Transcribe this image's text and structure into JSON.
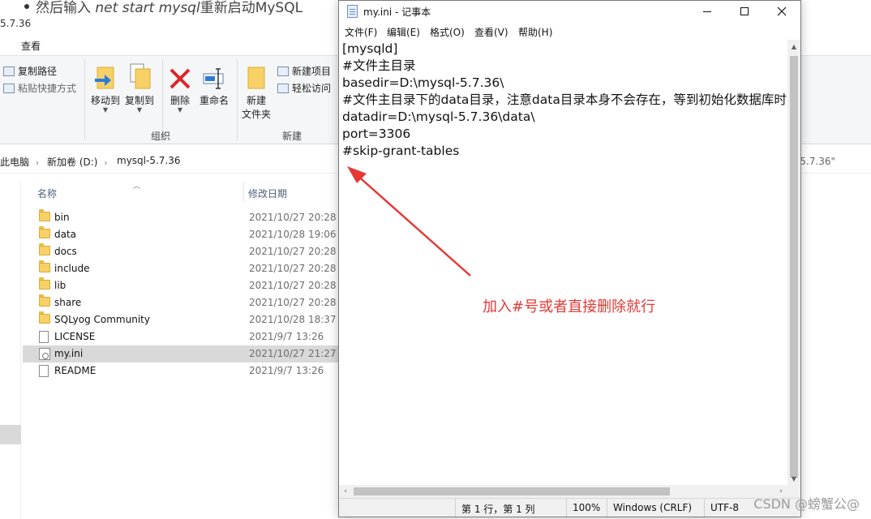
{
  "blog": {
    "line_start": "然后输入 ",
    "line_cmd": "net start mysql",
    "line_end": "重新启动MySQL"
  },
  "explorer": {
    "title_fragment": "5.7.36",
    "tab_view": "查看",
    "ribbon": {
      "copy_path": "复制路径",
      "paste_shortcut": "粘贴快捷方式",
      "move_to": "移动到",
      "copy_to": "复制到",
      "delete": "删除",
      "rename": "重命名",
      "new_folder_line1": "新建",
      "new_folder_line2": "文件夹",
      "new_item": "新建项目",
      "easy_access": "轻松访问",
      "group_organize": "组织",
      "group_new": "新建"
    },
    "breadcrumb": [
      "此电脑",
      "新加卷 (D:)",
      "mysql-5.7.36"
    ],
    "search_fragment": "-5.7.36\"",
    "columns": {
      "name": "名称",
      "date": "修改日期"
    },
    "files": [
      {
        "name": "bin",
        "date": "2021/10/27 20:28",
        "type": "folder"
      },
      {
        "name": "data",
        "date": "2021/10/28 19:06",
        "type": "folder"
      },
      {
        "name": "docs",
        "date": "2021/10/27 20:28",
        "type": "folder"
      },
      {
        "name": "include",
        "date": "2021/10/27 20:28",
        "type": "folder"
      },
      {
        "name": "lib",
        "date": "2021/10/27 20:28",
        "type": "folder"
      },
      {
        "name": "share",
        "date": "2021/10/27 20:28",
        "type": "folder"
      },
      {
        "name": "SQLyog Community",
        "date": "2021/10/28 18:37",
        "type": "folder"
      },
      {
        "name": "LICENSE",
        "date": "2021/9/7 13:26",
        "type": "file"
      },
      {
        "name": "my.ini",
        "date": "2021/10/27 21:27",
        "type": "ini",
        "selected": true
      },
      {
        "name": "README",
        "date": "2021/9/7 13:26",
        "type": "file"
      }
    ]
  },
  "notepad": {
    "title": "my.ini - 记事本",
    "menu": [
      "文件(F)",
      "编辑(E)",
      "格式(O)",
      "查看(V)",
      "帮助(H)"
    ],
    "lines": [
      "[mysqld]",
      "#文件主目录",
      "basedir=D:\\mysql-5.7.36\\",
      "#文件主目录下的data目录，注意data目录本身不会存在，等到初始化数据库时",
      "datadir=D:\\mysql-5.7.36\\data\\",
      "port=3306",
      "#skip-grant-tables"
    ],
    "status": {
      "position": "第 1 行，第 1 列",
      "zoom": "100%",
      "line_ending": "Windows (CRLF)",
      "encoding": "UTF-8"
    }
  },
  "annotation": {
    "text": "加入#号或者直接删除就行",
    "color": "#e53935"
  },
  "watermark": "CSDN @螃蟹公@"
}
